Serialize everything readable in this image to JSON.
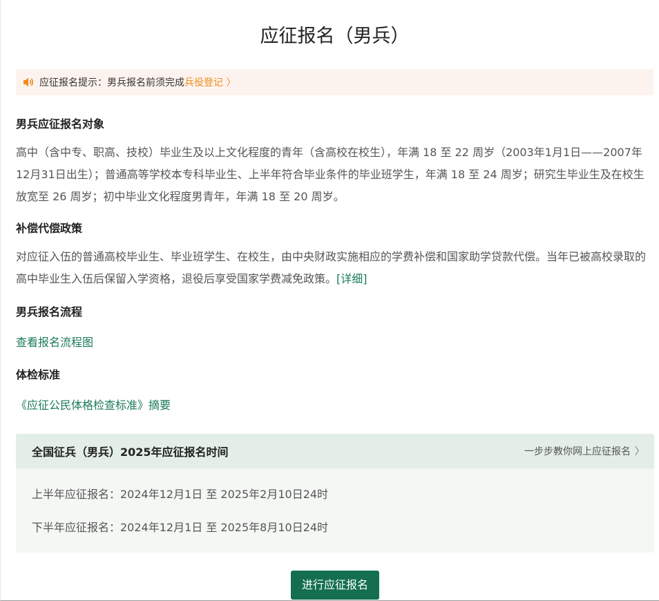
{
  "page": {
    "title": "应征报名（男兵）"
  },
  "notice": {
    "icon": "speaker-icon",
    "text": "应征报名提示：男兵报名前须完成",
    "link_text": "兵役登记",
    "link_chevron": "〉",
    "icon_color": "#f08a1c"
  },
  "sections": {
    "target": {
      "title": "男兵应征报名对象",
      "text": "高中（含中专、职高、技校）毕业生及以上文化程度的青年（含高校在校生），年满 18 至 22 周岁（2003年1月1日——2007年12月31日出生）；普通高等学校本专科毕业生、上半年符合毕业条件的毕业班学生，年满 18 至 24 周岁；研究生毕业生及在校生放宽至 26 周岁；初中毕业文化程度男青年，年满 18 至 20 周岁。"
    },
    "policy": {
      "title": "补偿代偿政策",
      "text": "对应征入伍的普通高校毕业生、毕业班学生、在校生，由中央财政实施相应的学费补偿和国家助学贷款代偿。当年已被高校录取的高中毕业生入伍后保留入学资格，退役后享受国家学费减免政策。",
      "link_text": "[详细]"
    },
    "process": {
      "title": "男兵报名流程",
      "link_text": "查看报名流程图"
    },
    "physical": {
      "title": "体检标准",
      "link_text": "《应征公民体格检查标准》摘要"
    }
  },
  "schedule": {
    "title": "全国征兵（男兵）2025年应征报名时间",
    "tip": "一步步教你网上应征报名",
    "tip_chevron": "〉",
    "rows": [
      "上半年应征报名：2024年12月1日 至 2025年2月10日24时",
      "下半年应征报名：2024年12月1日 至 2025年8月10日24时"
    ]
  },
  "action": {
    "button_label": "进行应征报名"
  },
  "colors": {
    "accent_green": "#136f4f",
    "link_green": "#1b7a5a",
    "notice_bg": "#fdf3ee",
    "schedule_head_bg": "#e2eee6"
  }
}
